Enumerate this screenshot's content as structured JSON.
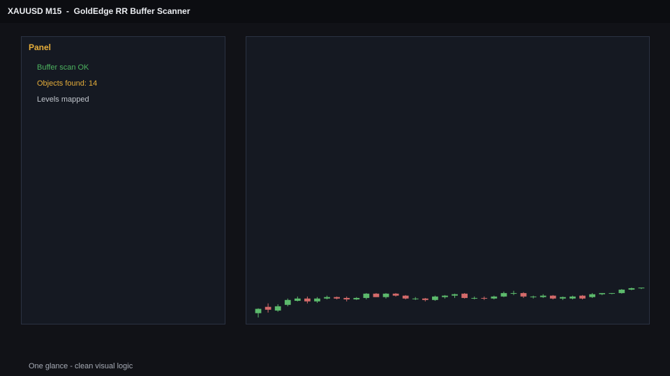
{
  "window": {
    "title": "XAUUSD M15  -  GoldEdge RR Buffer Scanner"
  },
  "panel": {
    "header": "Panel",
    "header_color": "#e5ad3a",
    "lines": [
      {
        "text": "Buffer scan OK",
        "color": "#4cb35f"
      },
      {
        "text": "Objects found: 14",
        "color": "#e5ad3a"
      },
      {
        "text": "Levels mapped",
        "color": "#c2c6cd"
      }
    ]
  },
  "footer": {
    "text": "One glance - clean visual logic"
  },
  "colors": {
    "bull": "#5cba6c",
    "bear": "#d46a6a",
    "background": "#111217",
    "panel_bg": "#151922",
    "border": "#2b3242"
  },
  "chart_data": {
    "type": "candlestick",
    "title": "",
    "xlabel": "",
    "ylabel": "",
    "ylim": [
      0,
      100
    ],
    "candles": [
      {
        "o": 3.7,
        "h": 5.4,
        "l": 2.2,
        "c": 5.2
      },
      {
        "o": 5.9,
        "h": 7.1,
        "l": 3.9,
        "c": 4.9
      },
      {
        "o": 4.6,
        "h": 6.8,
        "l": 4.2,
        "c": 6.1
      },
      {
        "o": 6.6,
        "h": 8.8,
        "l": 6.1,
        "c": 8.3
      },
      {
        "o": 8.0,
        "h": 9.5,
        "l": 7.8,
        "c": 8.8
      },
      {
        "o": 8.8,
        "h": 9.5,
        "l": 7.1,
        "c": 7.8
      },
      {
        "o": 7.8,
        "h": 9.3,
        "l": 7.3,
        "c": 8.8
      },
      {
        "o": 8.8,
        "h": 9.8,
        "l": 8.5,
        "c": 9.3
      },
      {
        "o": 9.3,
        "h": 9.5,
        "l": 8.5,
        "c": 8.8
      },
      {
        "o": 9.0,
        "h": 9.5,
        "l": 7.8,
        "c": 8.5
      },
      {
        "o": 8.5,
        "h": 9.3,
        "l": 8.3,
        "c": 9.0
      },
      {
        "o": 9.0,
        "h": 10.7,
        "l": 8.5,
        "c": 10.5
      },
      {
        "o": 10.5,
        "h": 10.7,
        "l": 9.3,
        "c": 9.3
      },
      {
        "o": 9.3,
        "h": 10.7,
        "l": 8.8,
        "c": 10.5
      },
      {
        "o": 10.5,
        "h": 10.7,
        "l": 9.5,
        "c": 9.8
      },
      {
        "o": 9.8,
        "h": 10.0,
        "l": 8.5,
        "c": 8.8
      },
      {
        "o": 8.8,
        "h": 9.3,
        "l": 8.3,
        "c": 8.8
      },
      {
        "o": 8.8,
        "h": 9.0,
        "l": 7.8,
        "c": 8.3
      },
      {
        "o": 8.3,
        "h": 9.8,
        "l": 8.0,
        "c": 9.5
      },
      {
        "o": 9.3,
        "h": 10.0,
        "l": 8.8,
        "c": 9.8
      },
      {
        "o": 9.8,
        "h": 10.5,
        "l": 9.0,
        "c": 10.3
      },
      {
        "o": 10.5,
        "h": 10.7,
        "l": 8.8,
        "c": 9.0
      },
      {
        "o": 9.0,
        "h": 9.5,
        "l": 8.5,
        "c": 9.0
      },
      {
        "o": 9.0,
        "h": 9.5,
        "l": 8.3,
        "c": 8.8
      },
      {
        "o": 8.8,
        "h": 9.8,
        "l": 8.5,
        "c": 9.5
      },
      {
        "o": 9.5,
        "h": 11.2,
        "l": 9.3,
        "c": 10.7
      },
      {
        "o": 10.5,
        "h": 11.5,
        "l": 10.0,
        "c": 10.7
      },
      {
        "o": 10.7,
        "h": 11.0,
        "l": 9.0,
        "c": 9.5
      },
      {
        "o": 9.3,
        "h": 9.8,
        "l": 8.8,
        "c": 9.5
      },
      {
        "o": 9.3,
        "h": 10.3,
        "l": 9.0,
        "c": 9.8
      },
      {
        "o": 9.8,
        "h": 10.0,
        "l": 8.5,
        "c": 8.8
      },
      {
        "o": 8.8,
        "h": 9.5,
        "l": 8.3,
        "c": 9.3
      },
      {
        "o": 8.8,
        "h": 9.8,
        "l": 8.5,
        "c": 9.5
      },
      {
        "o": 9.8,
        "h": 10.0,
        "l": 8.5,
        "c": 8.8
      },
      {
        "o": 9.3,
        "h": 10.7,
        "l": 9.0,
        "c": 10.3
      },
      {
        "o": 10.3,
        "h": 10.7,
        "l": 10.0,
        "c": 10.7
      },
      {
        "o": 10.7,
        "h": 10.7,
        "l": 10.3,
        "c": 10.7
      },
      {
        "o": 10.7,
        "h": 12.1,
        "l": 10.5,
        "c": 11.9
      },
      {
        "o": 11.9,
        "h": 12.6,
        "l": 11.7,
        "c": 12.4
      },
      {
        "o": 12.4,
        "h": 12.6,
        "l": 12.1,
        "c": 12.6
      }
    ]
  }
}
